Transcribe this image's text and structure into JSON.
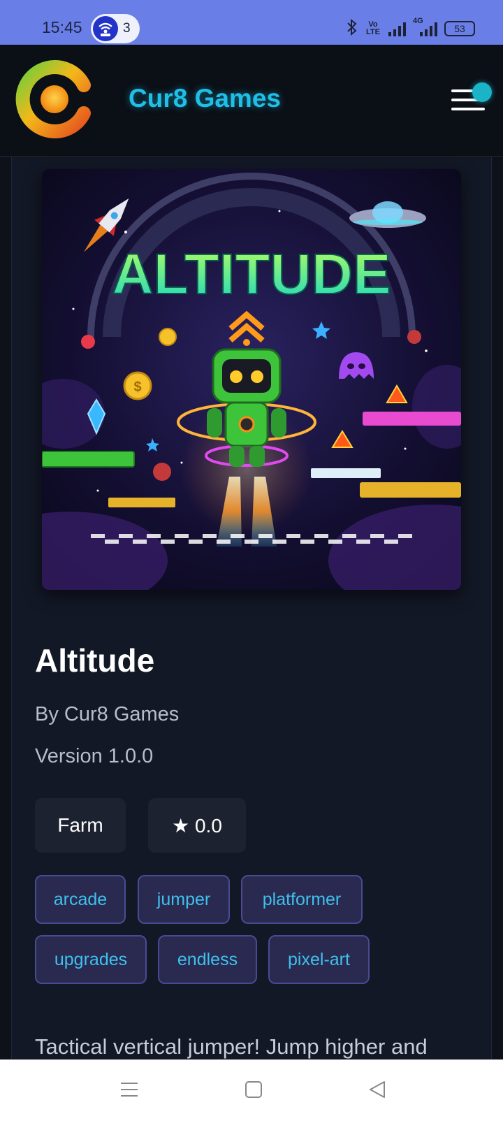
{
  "status_bar": {
    "time": "15:45",
    "hotspot_count": "3",
    "battery": "53",
    "network_label": "4G",
    "volte_label": "Vo LTE"
  },
  "header": {
    "brand": "Cur8 Games"
  },
  "game": {
    "cover_title": "ALTITUDE",
    "title": "Altitude",
    "author": "By Cur8 Games",
    "version": "Version 1.0.0",
    "genre": "Farm",
    "rating": "★ 0.0",
    "tags": [
      "arcade",
      "jumper",
      "platformer",
      "upgrades",
      "endless",
      "pixel-art"
    ],
    "description": "Tactical vertical jumper! Jump higher and"
  },
  "colors": {
    "status_bar": "#6a7ee8",
    "brand": "#1ec0e8",
    "background": "#0e1119",
    "tag_text": "#3ec1ec",
    "tag_bg": "#2a2950"
  },
  "icons": {
    "hotspot": "wifi-hotspot-icon",
    "bluetooth": "bluetooth-icon",
    "menu": "hamburger-menu-icon",
    "nav_recent": "recents-icon",
    "nav_home": "home-icon",
    "nav_back": "back-icon"
  }
}
